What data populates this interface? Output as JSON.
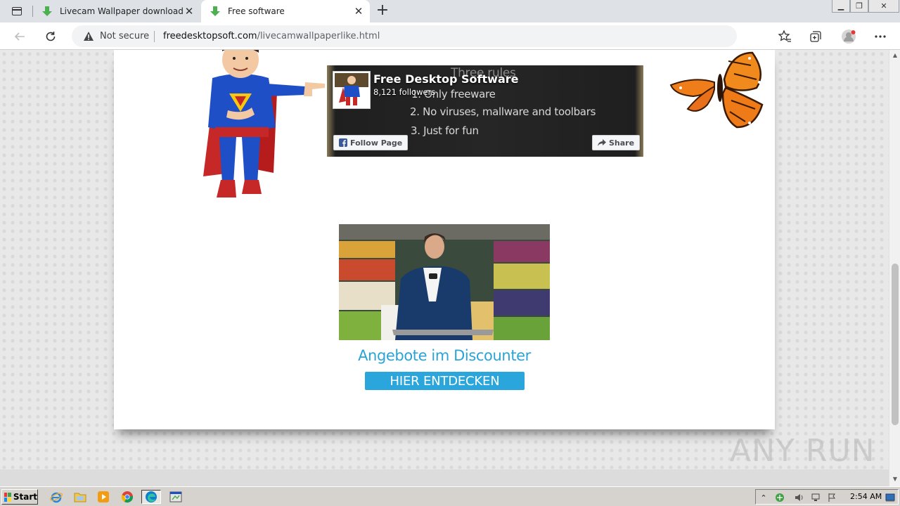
{
  "browser": {
    "tabs": [
      {
        "title": "Livecam Wallpaper download pa",
        "active": false
      },
      {
        "title": "Free software",
        "active": true
      }
    ],
    "new_tab_label": "+",
    "security_label": "Not secure",
    "url_host": "freedesktopsoft.com",
    "url_path": "/livecamwallpaperlike.html"
  },
  "facebook_widget": {
    "page_name": "Free Desktop Software",
    "followers": "8,121 followers",
    "follow_label": "Follow Page",
    "share_label": "Share",
    "cover_title": "Three rules",
    "cover_rules": [
      "1. Only freeware",
      "2. No viruses, mallware and toolbars",
      "3. Just for fun"
    ]
  },
  "ad": {
    "headline": "Angebote im Discounter",
    "cta": "HIER ENTDECKEN",
    "accent_color": "#2ba6dc"
  },
  "watermark": {
    "text": "ANY RUN"
  },
  "taskbar": {
    "start_label": "Start",
    "clock": "2:54 AM",
    "pinned": [
      "ie-icon",
      "folder-icon",
      "media-player-icon",
      "chrome-icon",
      "edge-icon",
      "app-icon"
    ]
  }
}
